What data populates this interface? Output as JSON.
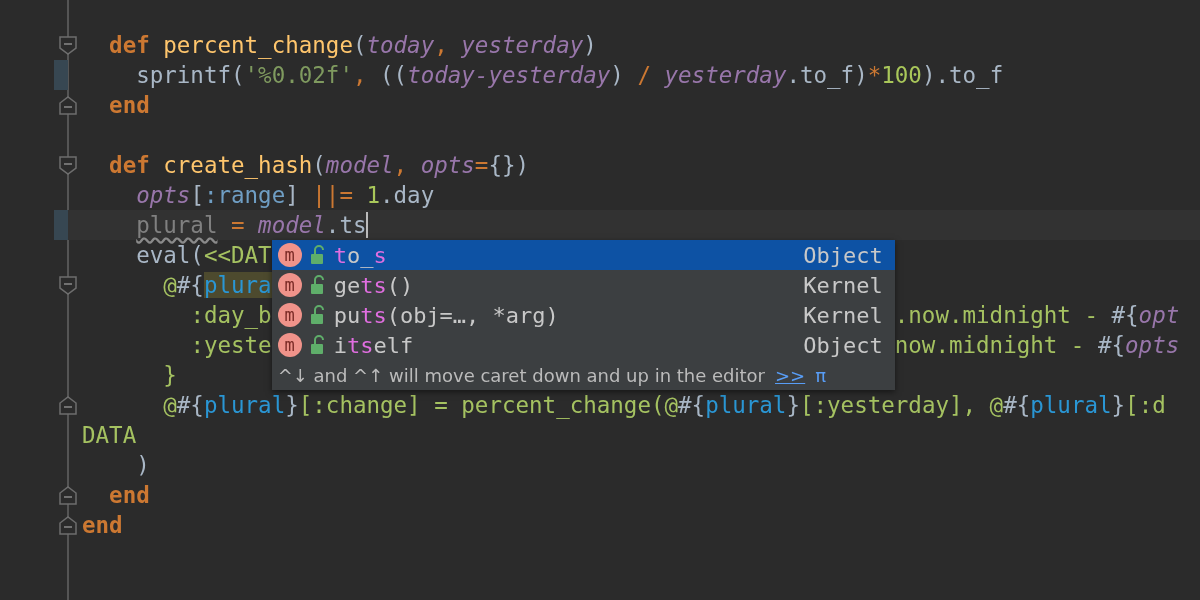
{
  "editor": {
    "lines": [
      {
        "changed": false,
        "current": false,
        "kind": "plain"
      },
      {
        "changed": false,
        "current": false,
        "kind": "fold_start",
        "tokens": [
          {
            "text": "  def ",
            "kind": "keyword"
          },
          {
            "text": "percent_change",
            "kind": "function"
          },
          {
            "text": "(",
            "kind": "plain"
          },
          {
            "text": "today",
            "kind": "param"
          },
          {
            "text": ", ",
            "kind": "operator"
          },
          {
            "text": "yesterday",
            "kind": "param"
          },
          {
            "text": ")",
            "kind": "plain"
          }
        ]
      },
      {
        "changed": true,
        "current": false,
        "kind": "plain",
        "tokens": [
          {
            "text": "    sprintf(",
            "kind": "plain"
          },
          {
            "text": "'%0.02f'",
            "kind": "string"
          },
          {
            "text": ", ",
            "kind": "operator"
          },
          {
            "text": "((",
            "kind": "plain"
          },
          {
            "text": "today-yesterday",
            "kind": "param"
          },
          {
            "text": ") ",
            "kind": "plain"
          },
          {
            "text": "/ ",
            "kind": "operator"
          },
          {
            "text": "yesterday",
            "kind": "param"
          },
          {
            "text": ".to_f)",
            "kind": "plain"
          },
          {
            "text": "*",
            "kind": "operator"
          },
          {
            "text": "100",
            "kind": "number"
          },
          {
            "text": ").to_f",
            "kind": "plain"
          }
        ]
      },
      {
        "changed": false,
        "current": false,
        "kind": "fold_end",
        "tokens": [
          {
            "text": "  end",
            "kind": "keyword"
          }
        ]
      },
      {
        "changed": false,
        "current": false,
        "kind": "plain"
      },
      {
        "changed": false,
        "current": false,
        "kind": "fold_start",
        "tokens": [
          {
            "text": "  def ",
            "kind": "keyword"
          },
          {
            "text": "create_hash",
            "kind": "function"
          },
          {
            "text": "(",
            "kind": "plain"
          },
          {
            "text": "model",
            "kind": "param"
          },
          {
            "text": ", ",
            "kind": "operator"
          },
          {
            "text": "opts",
            "kind": "param"
          },
          {
            "text": "=",
            "kind": "operator"
          },
          {
            "text": "{})",
            "kind": "plain"
          }
        ]
      },
      {
        "changed": false,
        "current": false,
        "kind": "plain",
        "tokens": [
          {
            "text": "    opts",
            "kind": "param"
          },
          {
            "text": "[",
            "kind": "plain"
          },
          {
            "text": ":range",
            "kind": "symbol"
          },
          {
            "text": "] ",
            "kind": "plain"
          },
          {
            "text": "||= ",
            "kind": "operator"
          },
          {
            "text": "1",
            "kind": "number"
          },
          {
            "text": ".day",
            "kind": "plain"
          }
        ]
      },
      {
        "changed": true,
        "current": true,
        "kind": "plain",
        "tokens": [
          {
            "text": "    plural",
            "kind": "unused"
          },
          {
            "text": " = ",
            "kind": "operator"
          },
          {
            "text": "model",
            "kind": "param"
          },
          {
            "text": ".ts",
            "kind": "plain"
          }
        ]
      },
      {
        "changed": false,
        "current": false,
        "kind": "plain",
        "tokens": [
          {
            "text": "    eval(",
            "kind": "plain"
          },
          {
            "text": "<<DAT",
            "kind": "heredoc"
          }
        ]
      },
      {
        "changed": false,
        "current": false,
        "kind": "fold_start",
        "tokens": [
          {
            "text": "      @",
            "kind": "heredoc"
          },
          {
            "text": "#{",
            "kind": "plain"
          },
          {
            "text": "plura",
            "kind": "match"
          }
        ]
      },
      {
        "changed": false,
        "current": false,
        "kind": "plain",
        "tokens": [
          {
            "text": "        :day_b",
            "kind": "heredoc"
          }
        ],
        "right": [
          {
            "text": ".now.midnight - ",
            "kind": "heredoc"
          },
          {
            "text": "#{",
            "kind": "plain"
          },
          {
            "text": "opt",
            "kind": "param"
          }
        ]
      },
      {
        "changed": false,
        "current": false,
        "kind": "plain",
        "tokens": [
          {
            "text": "        :yeste",
            "kind": "heredoc"
          }
        ],
        "right": [
          {
            "text": "now.midnight - ",
            "kind": "heredoc"
          },
          {
            "text": "#{",
            "kind": "plain"
          },
          {
            "text": "opts",
            "kind": "param"
          }
        ]
      },
      {
        "changed": false,
        "current": false,
        "kind": "plain",
        "tokens": [
          {
            "text": "      }",
            "kind": "heredoc"
          }
        ]
      },
      {
        "changed": false,
        "current": false,
        "kind": "fold_end",
        "tokens": [
          {
            "text": "      @",
            "kind": "heredoc"
          },
          {
            "text": "#{",
            "kind": "plain"
          },
          {
            "text": "plural",
            "kind": "interp"
          },
          {
            "text": "}",
            "kind": "plain"
          },
          {
            "text": "[:change] = percent_change(@",
            "kind": "heredoc"
          },
          {
            "text": "#{",
            "kind": "plain"
          },
          {
            "text": "plural",
            "kind": "interp"
          },
          {
            "text": "}",
            "kind": "plain"
          },
          {
            "text": "[:yesterday], @",
            "kind": "heredoc"
          },
          {
            "text": "#{",
            "kind": "plain"
          },
          {
            "text": "plural",
            "kind": "interp"
          },
          {
            "text": "}",
            "kind": "plain"
          },
          {
            "text": "[:d",
            "kind": "heredoc"
          }
        ]
      },
      {
        "changed": false,
        "current": false,
        "kind": "plain",
        "tokens": [
          {
            "text": "DATA",
            "kind": "heredoc"
          }
        ]
      },
      {
        "changed": false,
        "current": false,
        "kind": "plain",
        "tokens": [
          {
            "text": "    )",
            "kind": "plain"
          }
        ]
      },
      {
        "changed": false,
        "current": false,
        "kind": "fold_end",
        "tokens": [
          {
            "text": "  end",
            "kind": "keyword"
          }
        ]
      },
      {
        "changed": false,
        "current": false,
        "kind": "fold_end",
        "tokens": [
          {
            "text": "end",
            "kind": "keyword"
          }
        ]
      }
    ]
  },
  "completion": {
    "items": [
      {
        "selected": true,
        "badge": "m",
        "parts": [
          {
            "text": "t",
            "matched": true
          },
          {
            "text": "o_",
            "matched": false
          },
          {
            "text": "s",
            "matched": true
          }
        ],
        "type": "Object"
      },
      {
        "selected": false,
        "badge": "m",
        "parts": [
          {
            "text": "ge",
            "matched": false
          },
          {
            "text": "ts",
            "matched": true
          },
          {
            "text": "()",
            "matched": false
          }
        ],
        "type": "Kernel"
      },
      {
        "selected": false,
        "badge": "m",
        "parts": [
          {
            "text": "pu",
            "matched": false
          },
          {
            "text": "ts",
            "matched": true
          },
          {
            "text": "(obj=…, *arg)",
            "matched": false
          }
        ],
        "type": "Kernel"
      },
      {
        "selected": false,
        "badge": "m",
        "parts": [
          {
            "text": "i",
            "matched": false
          },
          {
            "text": "ts",
            "matched": true
          },
          {
            "text": "elf",
            "matched": false
          }
        ],
        "type": "Object"
      }
    ],
    "footer": {
      "hint": "^↓ and ^↑ will move caret down and up in the editor",
      "link": ">>",
      "pin": "π"
    }
  }
}
